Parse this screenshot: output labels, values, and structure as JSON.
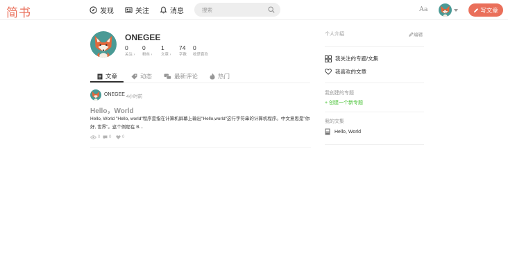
{
  "header": {
    "logo": "简书",
    "nav": [
      {
        "label": "发现",
        "icon": "compass-icon"
      },
      {
        "label": "关注",
        "icon": "following-icon"
      },
      {
        "label": "消息",
        "icon": "bell-icon"
      }
    ],
    "search": {
      "placeholder": "搜索",
      "value": ""
    },
    "font_toggle": "Aa",
    "write_button": "写文章",
    "accent_color": "#ea6f5a"
  },
  "profile": {
    "username": "ONEGEE",
    "stats": [
      {
        "value": "0",
        "label": "关注 ›"
      },
      {
        "value": "0",
        "label": "粉丝 ›"
      },
      {
        "value": "1",
        "label": "文章 ›"
      },
      {
        "value": "74",
        "label": "字数"
      },
      {
        "value": "0",
        "label": "收获喜欢"
      }
    ]
  },
  "tabs": [
    {
      "label": "文章",
      "icon": "document-icon",
      "active": true
    },
    {
      "label": "动态",
      "icon": "tag-icon",
      "active": false
    },
    {
      "label": "最新评论",
      "icon": "comments-icon",
      "active": false
    },
    {
      "label": "热门",
      "icon": "fire-icon",
      "active": false
    }
  ],
  "article": {
    "author": "ONEGEE",
    "time": "4小时前",
    "title": "Hello，World",
    "abstract": "Hello, World \"Hello, world\"程序是指在计算机屏幕上输出\"Hello,world\"这行字符串的计算机程序。中文意思是\"你好, 世界\"。这个例程在 B...",
    "views": "0",
    "comments": "0",
    "likes": "0"
  },
  "sidebar": {
    "intro_label": "个人介绍",
    "edit_label": "编辑",
    "links": [
      {
        "label": "我关注的专题/文集",
        "icon": "grid-icon"
      },
      {
        "label": "我喜欢的文章",
        "icon": "heart-icon"
      }
    ],
    "collections_label": "我创建的专题",
    "new_collection": "+ 创建一个新专题",
    "notebooks_label": "我的文集",
    "notebooks": [
      {
        "label": "Hello, World",
        "icon": "notebook-icon"
      }
    ]
  }
}
